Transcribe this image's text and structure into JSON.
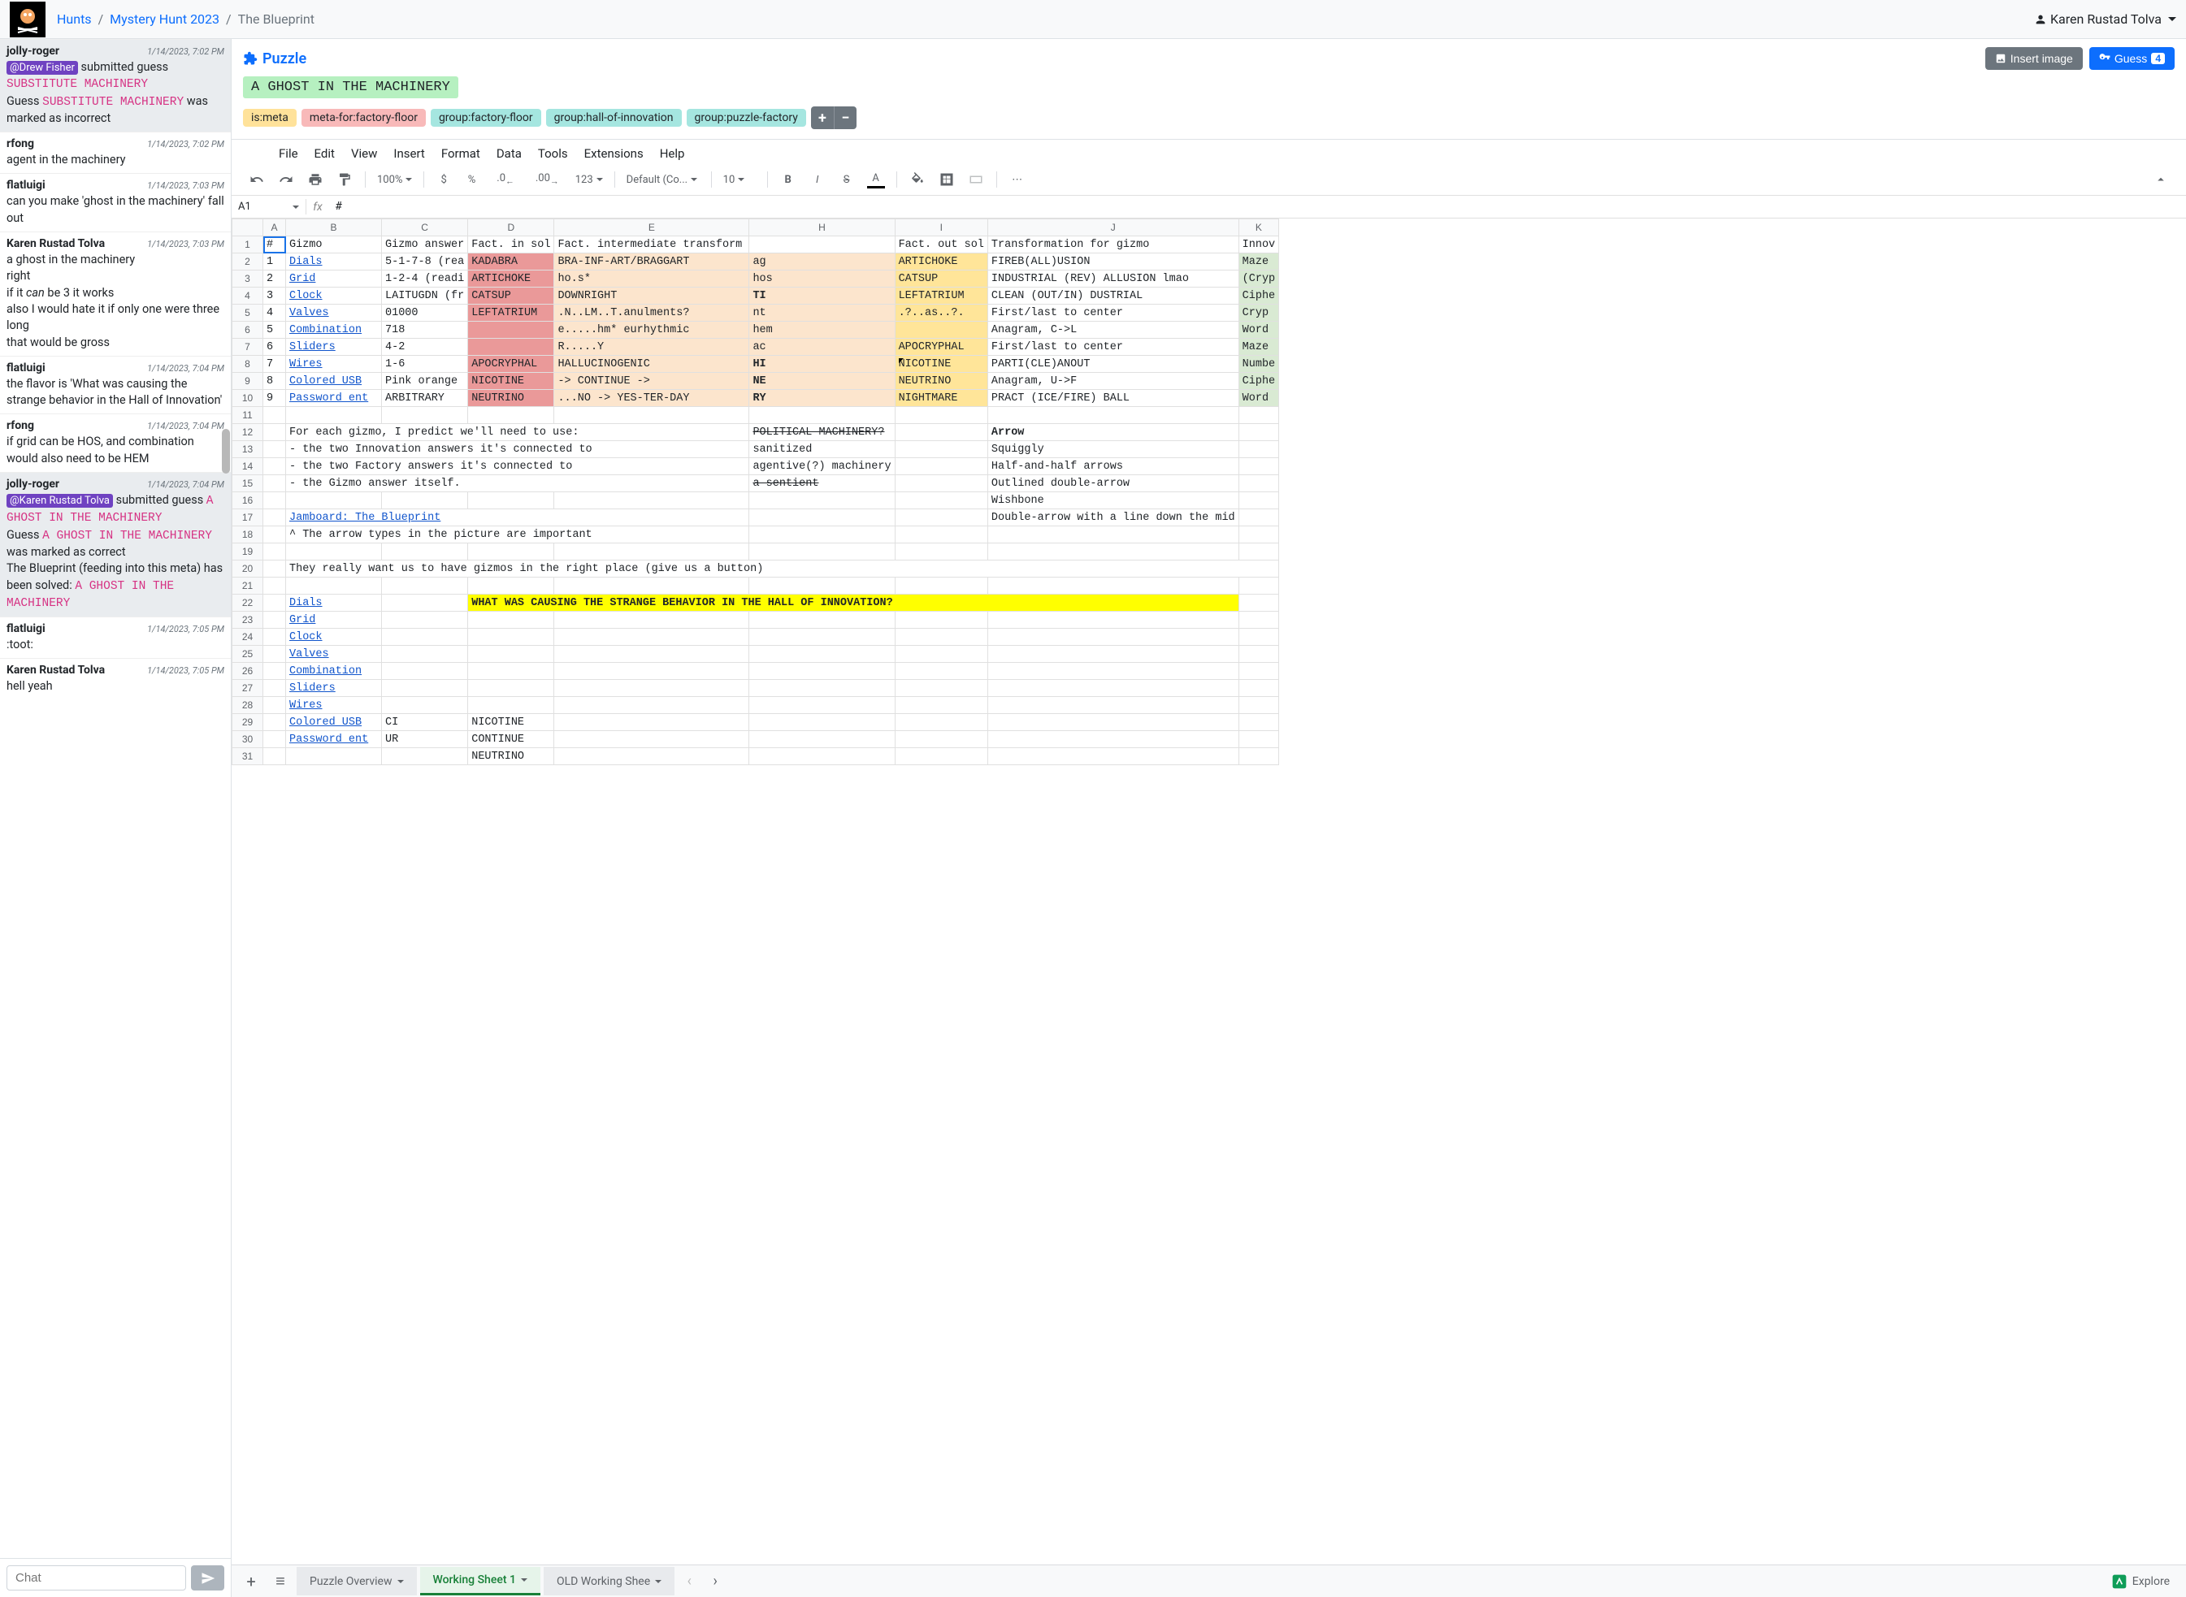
{
  "breadcrumb": {
    "hunts": "Hunts",
    "hunt": "Mystery Hunt 2023",
    "puzzle": "The Blueprint"
  },
  "user": {
    "name": "Karen Rustad Tolva"
  },
  "puzzleHeader": {
    "title": "Puzzle",
    "answer": "A GHOST IN THE MACHINERY",
    "insertImage": "Insert image",
    "guess": "Guess",
    "guessCount": "4",
    "tags": [
      "is:meta",
      "meta-for:factory-floor",
      "group:factory-floor",
      "group:hall-of-innovation",
      "group:puzzle-factory"
    ]
  },
  "chatMessages": [
    {
      "hl": true,
      "user": "jolly-roger",
      "time": "1/14/2023, 7:02 PM",
      "body": [
        {
          "t": "mention",
          "v": "@Drew Fisher"
        },
        {
          "t": "text",
          "v": " submitted guess "
        },
        {
          "t": "guess",
          "v": "SUBSTITUTE MACHINERY"
        },
        {
          "t": "br"
        },
        {
          "t": "text",
          "v": "Guess "
        },
        {
          "t": "guess",
          "v": "SUBSTITUTE MACHINERY"
        },
        {
          "t": "text",
          "v": " was marked as incorrect"
        }
      ]
    },
    {
      "user": "rfong",
      "time": "1/14/2023, 7:02 PM",
      "body": [
        {
          "t": "text",
          "v": "agent in the machinery"
        }
      ]
    },
    {
      "user": "flatluigi",
      "time": "1/14/2023, 7:03 PM",
      "body": [
        {
          "t": "text",
          "v": "can you make 'ghost in the machinery' fall out"
        }
      ]
    },
    {
      "user": "Karen Rustad Tolva",
      "time": "1/14/2023, 7:03 PM",
      "body": [
        {
          "t": "text",
          "v": "a ghost in the machinery"
        },
        {
          "t": "br"
        },
        {
          "t": "text",
          "v": "right"
        },
        {
          "t": "br"
        },
        {
          "t": "text",
          "v": "if it "
        },
        {
          "t": "i",
          "v": "can"
        },
        {
          "t": "text",
          "v": " be 3 it works"
        },
        {
          "t": "br"
        },
        {
          "t": "text",
          "v": "also I would hate it if only one were three long"
        },
        {
          "t": "br"
        },
        {
          "t": "text",
          "v": "that would be gross"
        }
      ]
    },
    {
      "user": "flatluigi",
      "time": "1/14/2023, 7:04 PM",
      "body": [
        {
          "t": "text",
          "v": "the flavor is 'What was causing the strange behavior in the Hall of Innovation'"
        }
      ]
    },
    {
      "user": "rfong",
      "time": "1/14/2023, 7:04 PM",
      "body": [
        {
          "t": "text",
          "v": "if grid can be HOS, and combination would also need to be HEM"
        }
      ]
    },
    {
      "hl": true,
      "user": "jolly-roger",
      "time": "1/14/2023, 7:04 PM",
      "body": [
        {
          "t": "mention",
          "v": "@Karen Rustad Tolva"
        },
        {
          "t": "text",
          "v": " submitted guess "
        },
        {
          "t": "guess",
          "v": "A GHOST IN THE MACHINERY"
        },
        {
          "t": "br"
        },
        {
          "t": "text",
          "v": "Guess "
        },
        {
          "t": "guess",
          "v": "A GHOST IN THE MACHINERY"
        },
        {
          "t": "text",
          "v": " was marked as correct"
        },
        {
          "t": "br"
        },
        {
          "t": "text",
          "v": "The Blueprint (feeding into this meta) has been solved: "
        },
        {
          "t": "guess",
          "v": "A GHOST IN THE MACHINERY"
        }
      ]
    },
    {
      "user": "flatluigi",
      "time": "1/14/2023, 7:05 PM",
      "body": [
        {
          "t": "text",
          "v": ":toot:"
        }
      ]
    },
    {
      "user": "Karen Rustad Tolva",
      "time": "1/14/2023, 7:05 PM",
      "body": [
        {
          "t": "text",
          "v": "hell yeah"
        }
      ]
    }
  ],
  "chatPlaceholder": "Chat",
  "sheetMenubar": [
    "File",
    "Edit",
    "View",
    "Insert",
    "Format",
    "Data",
    "Tools",
    "Extensions",
    "Help"
  ],
  "toolbar": {
    "zoom": "100%",
    "font": "Default (Co...",
    "fontSize": "10",
    "numfmt": "123"
  },
  "namebox": "A1",
  "formulaValue": "#",
  "columns": [
    "A",
    "B",
    "C",
    "D",
    "E",
    "H",
    "I",
    "J",
    "K"
  ],
  "headerRow": [
    "#",
    "Gizmo",
    "Gizmo answer",
    "Fact. in sol",
    "Fact. intermediate transform",
    "",
    "Fact. out sol",
    "Transformation for gizmo",
    "Innov"
  ],
  "rows": [
    {
      "n": 1,
      "cells": [
        {
          "v": "1"
        },
        {
          "v": "Dials",
          "link": true
        },
        {
          "v": "5-1-7-8 (rea"
        },
        {
          "v": "KADABRA",
          "cls": "bg-red"
        },
        {
          "v": "BRA-INF-ART/BRAGGART",
          "cls": "bg-orange"
        },
        {
          "v": "ag",
          "cls": "bg-orange"
        },
        {
          "v": "ARTICHOKE",
          "cls": "bg-yellow"
        },
        {
          "v": "FIREB(ALL)USION"
        },
        {
          "v": "Maze",
          "cls": "bg-green"
        }
      ]
    },
    {
      "n": 2,
      "cells": [
        {
          "v": "2"
        },
        {
          "v": "Grid",
          "link": true
        },
        {
          "v": "1-2-4 (readi"
        },
        {
          "v": "ARTICHOKE",
          "cls": "bg-red"
        },
        {
          "v": "ho.s*",
          "cls": "bg-orange"
        },
        {
          "v": "hos",
          "cls": "bg-orange"
        },
        {
          "v": "CATSUP",
          "cls": "bg-yellow"
        },
        {
          "v": "INDUSTRIAL (REV) ALLUSION lmao"
        },
        {
          "v": "(Cryp",
          "cls": "bg-green"
        }
      ]
    },
    {
      "n": 3,
      "cells": [
        {
          "v": "3"
        },
        {
          "v": "Clock",
          "link": true
        },
        {
          "v": "LAITUGDN (fr"
        },
        {
          "v": "CATSUP",
          "cls": "bg-red"
        },
        {
          "v": "DOWNRIGHT",
          "cls": "bg-orange"
        },
        {
          "v": "TI",
          "cls": "bg-orange bold"
        },
        {
          "v": "LEFTATRIUM",
          "cls": "bg-yellow"
        },
        {
          "v": "CLEAN (OUT/IN) DUSTRIAL"
        },
        {
          "v": "Ciphe",
          "cls": "bg-green"
        }
      ]
    },
    {
      "n": 4,
      "cells": [
        {
          "v": "4"
        },
        {
          "v": "Valves",
          "link": true
        },
        {
          "v": "01000"
        },
        {
          "v": "LEFTATRIUM",
          "cls": "bg-red"
        },
        {
          "v": ".N..LM..T.anulments?",
          "cls": "bg-orange"
        },
        {
          "v": "nt",
          "cls": "bg-orange"
        },
        {
          "v": ".?..as..?.",
          "cls": "bg-yellow"
        },
        {
          "v": "First/last to center"
        },
        {
          "v": "Cryp",
          "cls": "bg-green"
        }
      ]
    },
    {
      "n": 5,
      "cells": [
        {
          "v": "5"
        },
        {
          "v": "Combination",
          "link": true
        },
        {
          "v": "718"
        },
        {
          "v": "",
          "cls": "bg-red"
        },
        {
          "v": "e.....hm* eurhythmic",
          "cls": "bg-orange"
        },
        {
          "v": "hem",
          "cls": "bg-orange"
        },
        {
          "v": "",
          "cls": "bg-yellow"
        },
        {
          "v": "Anagram, C->L"
        },
        {
          "v": "Word",
          "cls": "bg-green"
        }
      ]
    },
    {
      "n": 6,
      "cells": [
        {
          "v": "6"
        },
        {
          "v": "Sliders",
          "link": true
        },
        {
          "v": "4-2"
        },
        {
          "v": "",
          "cls": "bg-red"
        },
        {
          "v": "R.....Y",
          "cls": "bg-orange"
        },
        {
          "v": "ac",
          "cls": "bg-orange"
        },
        {
          "v": "APOCRYPHAL",
          "cls": "bg-yellow"
        },
        {
          "v": "First/last to center"
        },
        {
          "v": "Maze",
          "cls": "bg-green"
        }
      ]
    },
    {
      "n": 7,
      "cells": [
        {
          "v": "7"
        },
        {
          "v": "Wires",
          "link": true
        },
        {
          "v": "1-6"
        },
        {
          "v": "APOCRYPHAL",
          "cls": "bg-red"
        },
        {
          "v": "HALLUCINOGENIC",
          "cls": "bg-orange"
        },
        {
          "v": "HI",
          "cls": "bg-orange bold"
        },
        {
          "v": "NICOTINE",
          "cls": "bg-yellow",
          "marker": true
        },
        {
          "v": "PARTI(CLE)ANOUT"
        },
        {
          "v": "Numbe",
          "cls": "bg-green"
        }
      ]
    },
    {
      "n": 8,
      "cells": [
        {
          "v": "8"
        },
        {
          "v": "Colored USB",
          "link": true
        },
        {
          "v": "Pink orange"
        },
        {
          "v": "NICOTINE",
          "cls": "bg-red"
        },
        {
          "v": "-> CONTINUE ->",
          "cls": "bg-orange"
        },
        {
          "v": "NE",
          "cls": "bg-orange bold"
        },
        {
          "v": "NEUTRINO",
          "cls": "bg-yellow"
        },
        {
          "v": "Anagram, U->F"
        },
        {
          "v": "Ciphe",
          "cls": "bg-green"
        }
      ]
    },
    {
      "n": 9,
      "cells": [
        {
          "v": "9"
        },
        {
          "v": "Password ent",
          "link": true
        },
        {
          "v": "ARBITRARY"
        },
        {
          "v": "NEUTRINO",
          "cls": "bg-red"
        },
        {
          "v": "...NO -> YES-TER-DAY",
          "cls": "bg-orange"
        },
        {
          "v": "RY",
          "cls": "bg-orange bold"
        },
        {
          "v": "NIGHTMARE",
          "cls": "bg-yellow"
        },
        {
          "v": "PRACT (ICE/FIRE) BALL"
        },
        {
          "v": "Word",
          "cls": "bg-green"
        }
      ]
    },
    {
      "n": 10,
      "cells": [
        {
          "v": ""
        },
        {
          "v": ""
        },
        {
          "v": ""
        },
        {
          "v": ""
        },
        {
          "v": ""
        },
        {
          "v": ""
        },
        {
          "v": ""
        },
        {
          "v": ""
        },
        {
          "v": ""
        }
      ]
    },
    {
      "n": 11,
      "cells": [
        {
          "v": ""
        },
        {
          "v": "For each gizmo, I predict we'll need to use:",
          "span": 4
        },
        {
          "v": "POLITICAL MACHINERY?",
          "cls": "strike"
        },
        {
          "v": ""
        },
        {
          "v": "Arrow",
          "cls": "bold"
        },
        {
          "v": ""
        }
      ]
    },
    {
      "n": 12,
      "cells": [
        {
          "v": ""
        },
        {
          "v": "- the two Innovation answers it's connected to",
          "span": 4
        },
        {
          "v": "sanitized"
        },
        {
          "v": ""
        },
        {
          "v": "Squiggly"
        },
        {
          "v": ""
        }
      ]
    },
    {
      "n": 13,
      "cells": [
        {
          "v": ""
        },
        {
          "v": "- the two Factory answers it's connected to",
          "span": 4
        },
        {
          "v": "agentive(?) machinery"
        },
        {
          "v": ""
        },
        {
          "v": "Half-and-half arrows"
        },
        {
          "v": ""
        }
      ]
    },
    {
      "n": 14,
      "cells": [
        {
          "v": ""
        },
        {
          "v": "- the Gizmo answer itself.",
          "span": 4
        },
        {
          "v": "a sentient",
          "cls": "strike"
        },
        {
          "v": ""
        },
        {
          "v": "Outlined double-arrow"
        },
        {
          "v": ""
        }
      ]
    },
    {
      "n": 15,
      "cells": [
        {
          "v": ""
        },
        {
          "v": ""
        },
        {
          "v": ""
        },
        {
          "v": ""
        },
        {
          "v": ""
        },
        {
          "v": ""
        },
        {
          "v": ""
        },
        {
          "v": "Wishbone"
        },
        {
          "v": ""
        }
      ]
    },
    {
      "n": 16,
      "cells": [
        {
          "v": ""
        },
        {
          "v": "Jamboard: The Blueprint",
          "link": true,
          "span": 4
        },
        {
          "v": ""
        },
        {
          "v": ""
        },
        {
          "v": "Double-arrow with a line down the mid"
        },
        {
          "v": ""
        }
      ]
    },
    {
      "n": 17,
      "cells": [
        {
          "v": ""
        },
        {
          "v": "^ The arrow types in the picture are important",
          "span": 4
        },
        {
          "v": ""
        },
        {
          "v": ""
        },
        {
          "v": ""
        },
        {
          "v": ""
        }
      ]
    },
    {
      "n": 18,
      "cells": [
        {
          "v": ""
        },
        {
          "v": ""
        },
        {
          "v": ""
        },
        {
          "v": ""
        },
        {
          "v": ""
        },
        {
          "v": ""
        },
        {
          "v": ""
        },
        {
          "v": ""
        },
        {
          "v": ""
        }
      ]
    },
    {
      "n": 19,
      "cells": [
        {
          "v": ""
        },
        {
          "v": "They really want us to have gizmos in the right place (give us a button)",
          "span": 8
        }
      ]
    },
    {
      "n": 20,
      "cells": [
        {
          "v": ""
        },
        {
          "v": ""
        },
        {
          "v": ""
        },
        {
          "v": ""
        },
        {
          "v": ""
        },
        {
          "v": ""
        },
        {
          "v": ""
        },
        {
          "v": ""
        },
        {
          "v": ""
        }
      ]
    },
    {
      "n": 21,
      "cells": [
        {
          "v": ""
        },
        {
          "v": "Dials",
          "link": true
        },
        {
          "v": ""
        },
        {
          "v": "WHAT WAS CAUSING THE STRANGE BEHAVIOR IN THE HALL OF INNOVATION?",
          "cls": "bg-hlyellow",
          "span": 5
        },
        {
          "v": ""
        }
      ]
    },
    {
      "n": 22,
      "cells": [
        {
          "v": ""
        },
        {
          "v": "Grid",
          "link": true
        },
        {
          "v": ""
        },
        {
          "v": ""
        },
        {
          "v": ""
        },
        {
          "v": ""
        },
        {
          "v": ""
        },
        {
          "v": ""
        },
        {
          "v": ""
        }
      ]
    },
    {
      "n": 23,
      "cells": [
        {
          "v": ""
        },
        {
          "v": "Clock",
          "link": true
        },
        {
          "v": ""
        },
        {
          "v": ""
        },
        {
          "v": ""
        },
        {
          "v": ""
        },
        {
          "v": ""
        },
        {
          "v": ""
        },
        {
          "v": ""
        }
      ]
    },
    {
      "n": 24,
      "cells": [
        {
          "v": ""
        },
        {
          "v": "Valves",
          "link": true
        },
        {
          "v": ""
        },
        {
          "v": ""
        },
        {
          "v": ""
        },
        {
          "v": ""
        },
        {
          "v": ""
        },
        {
          "v": ""
        },
        {
          "v": ""
        }
      ]
    },
    {
      "n": 25,
      "cells": [
        {
          "v": ""
        },
        {
          "v": "Combination",
          "link": true
        },
        {
          "v": ""
        },
        {
          "v": ""
        },
        {
          "v": ""
        },
        {
          "v": ""
        },
        {
          "v": ""
        },
        {
          "v": ""
        },
        {
          "v": ""
        }
      ]
    },
    {
      "n": 26,
      "cells": [
        {
          "v": ""
        },
        {
          "v": "Sliders",
          "link": true
        },
        {
          "v": ""
        },
        {
          "v": ""
        },
        {
          "v": ""
        },
        {
          "v": ""
        },
        {
          "v": ""
        },
        {
          "v": ""
        },
        {
          "v": ""
        }
      ]
    },
    {
      "n": 27,
      "cells": [
        {
          "v": ""
        },
        {
          "v": "Wires",
          "link": true
        },
        {
          "v": ""
        },
        {
          "v": ""
        },
        {
          "v": ""
        },
        {
          "v": ""
        },
        {
          "v": ""
        },
        {
          "v": ""
        },
        {
          "v": ""
        }
      ]
    },
    {
      "n": 28,
      "cells": [
        {
          "v": ""
        },
        {
          "v": "Colored USB",
          "link": true
        },
        {
          "v": "CI"
        },
        {
          "v": "NICOTINE"
        },
        {
          "v": ""
        },
        {
          "v": ""
        },
        {
          "v": ""
        },
        {
          "v": ""
        },
        {
          "v": ""
        }
      ]
    },
    {
      "n": 29,
      "cells": [
        {
          "v": ""
        },
        {
          "v": "Password ent",
          "link": true
        },
        {
          "v": "UR"
        },
        {
          "v": "CONTINUE"
        },
        {
          "v": ""
        },
        {
          "v": ""
        },
        {
          "v": ""
        },
        {
          "v": ""
        },
        {
          "v": ""
        }
      ]
    },
    {
      "n": 30,
      "cells": [
        {
          "v": ""
        },
        {
          "v": ""
        },
        {
          "v": ""
        },
        {
          "v": "NEUTRINO"
        },
        {
          "v": ""
        },
        {
          "v": ""
        },
        {
          "v": ""
        },
        {
          "v": ""
        },
        {
          "v": ""
        }
      ]
    }
  ],
  "sheetTabs": {
    "plus": "+",
    "menu": "≡",
    "tabs": [
      {
        "label": "Puzzle Overview",
        "active": false
      },
      {
        "label": "Working Sheet 1",
        "active": true
      },
      {
        "label": "OLD Working Shee",
        "active": false
      }
    ],
    "explore": "Explore"
  }
}
